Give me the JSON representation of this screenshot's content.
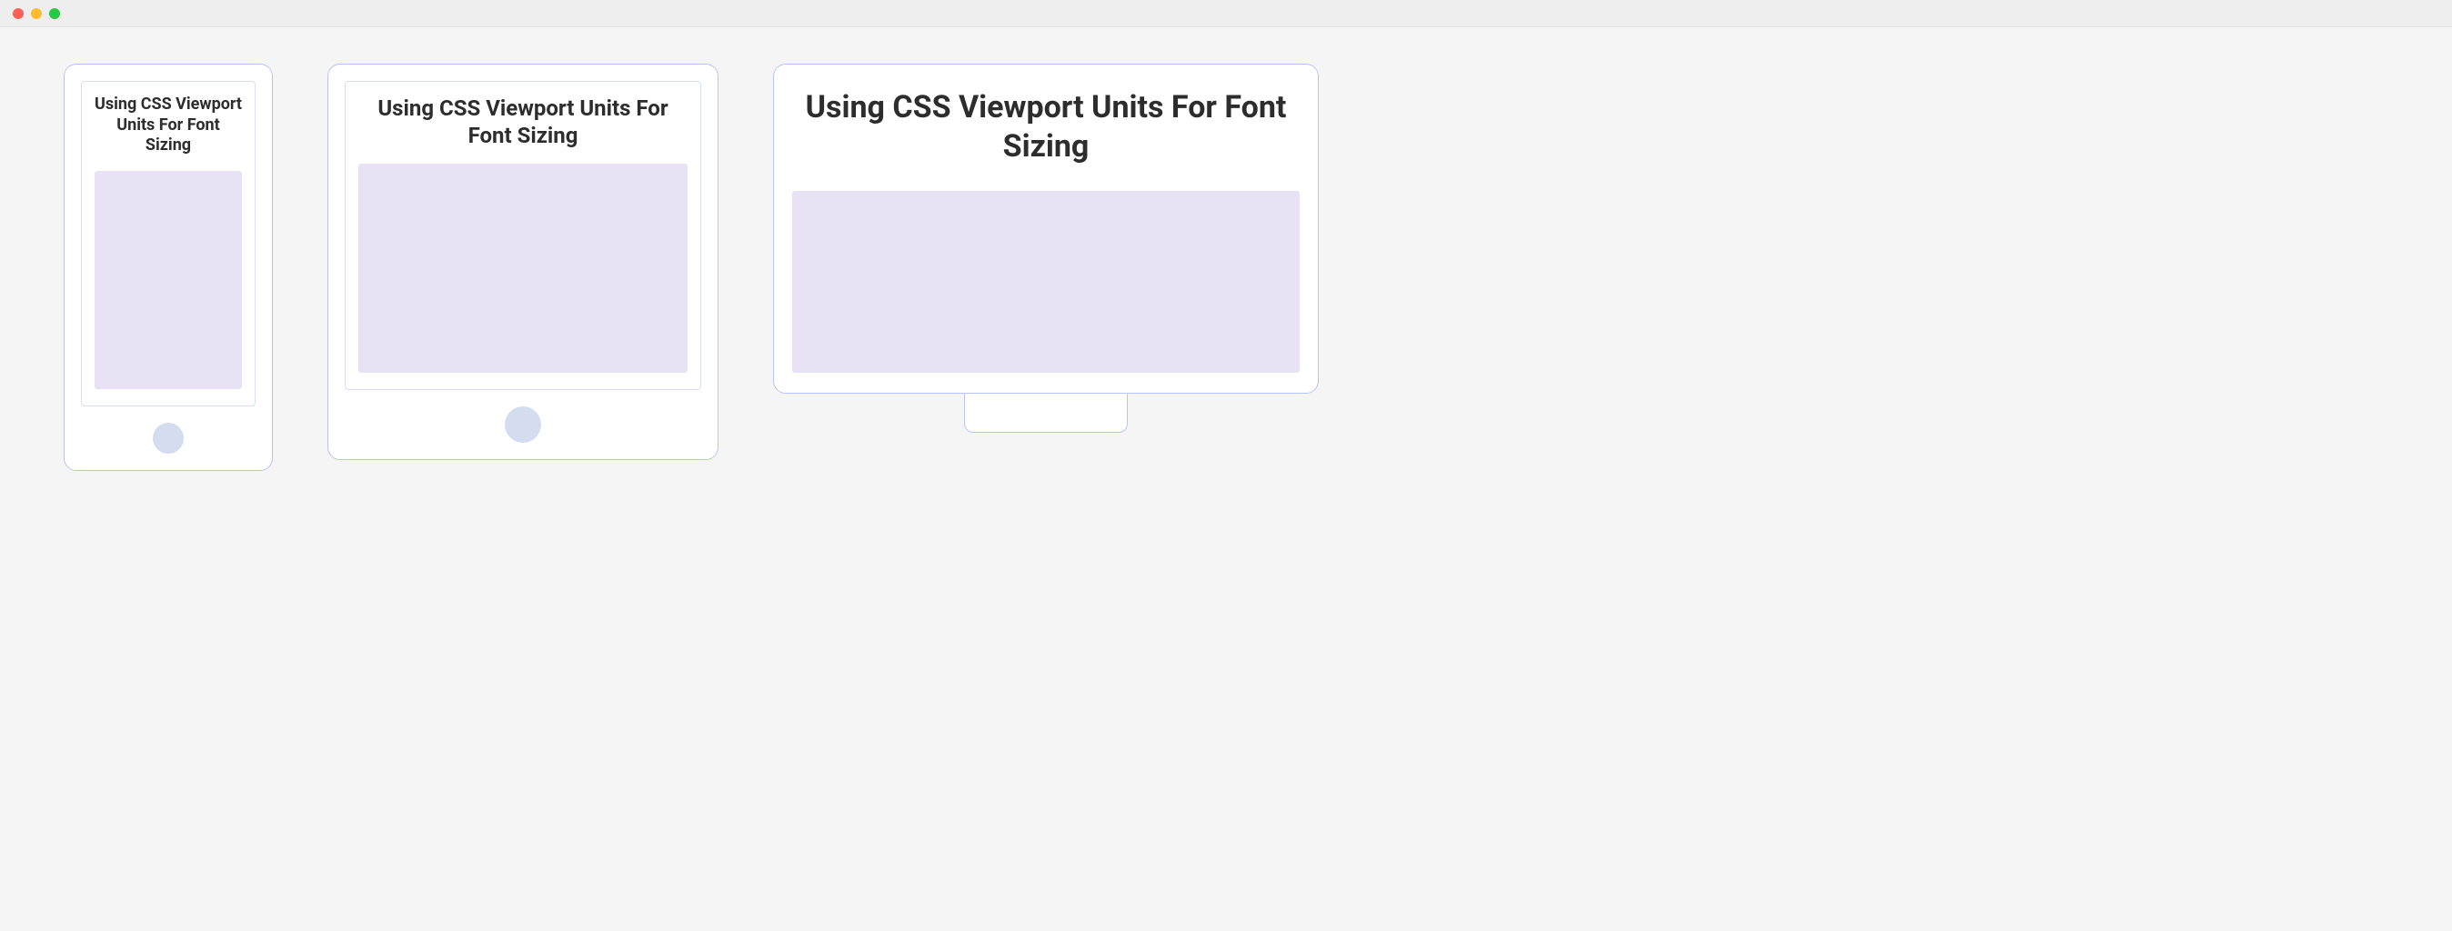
{
  "devices": {
    "phone": {
      "headline": "Using CSS Viewport Units For Font Sizing"
    },
    "tablet": {
      "headline": "Using CSS Viewport Units For Font Sizing"
    },
    "desktop": {
      "headline": "Using CSS Viewport Units For Font Sizing"
    }
  }
}
